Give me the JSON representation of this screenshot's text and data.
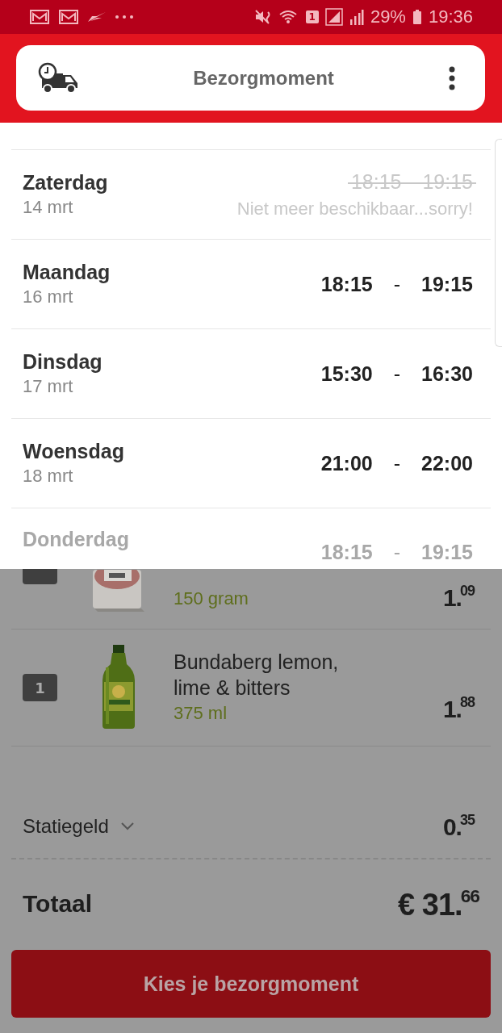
{
  "status_bar": {
    "sim": "1",
    "battery": "29%",
    "time": "19:36"
  },
  "header": {
    "title": "Bezorgmoment"
  },
  "slots": [
    {
      "day": "Zaterdag",
      "date": "14 mrt",
      "from": "18:15",
      "to": "19:15",
      "available": false,
      "faded": false,
      "note": "Niet meer beschikbaar...sorry!"
    },
    {
      "day": "Maandag",
      "date": "16 mrt",
      "from": "18:15",
      "sep": "-",
      "to": "19:15",
      "available": true,
      "faded": false
    },
    {
      "day": "Dinsdag",
      "date": "17 mrt",
      "from": "15:30",
      "sep": "-",
      "to": "16:30",
      "available": true,
      "faded": false
    },
    {
      "day": "Woensdag",
      "date": "18 mrt",
      "from": "21:00",
      "sep": "-",
      "to": "22:00",
      "available": true,
      "faded": false
    },
    {
      "day": "Donderdag",
      "from": "18:15",
      "sep": "-",
      "to": "19:15",
      "available": true,
      "faded": true
    }
  ],
  "cart": [
    {
      "kind": "pack",
      "amount": "150 gram",
      "price": "1.$^{09}$"
    },
    {
      "kind": "bottle",
      "quantity": "1",
      "name": "Bundaberg lemon, lime & bitters",
      "amount": "375 ml",
      "price": "1.$^{88}$"
    }
  ],
  "deposit": {
    "label": "Statiegeld",
    "price": "0.$^{35}$"
  },
  "total": {
    "label": "Totaal",
    "price": "€ 31.$^{66}$"
  },
  "button": "Kies je bezorgmoment"
}
